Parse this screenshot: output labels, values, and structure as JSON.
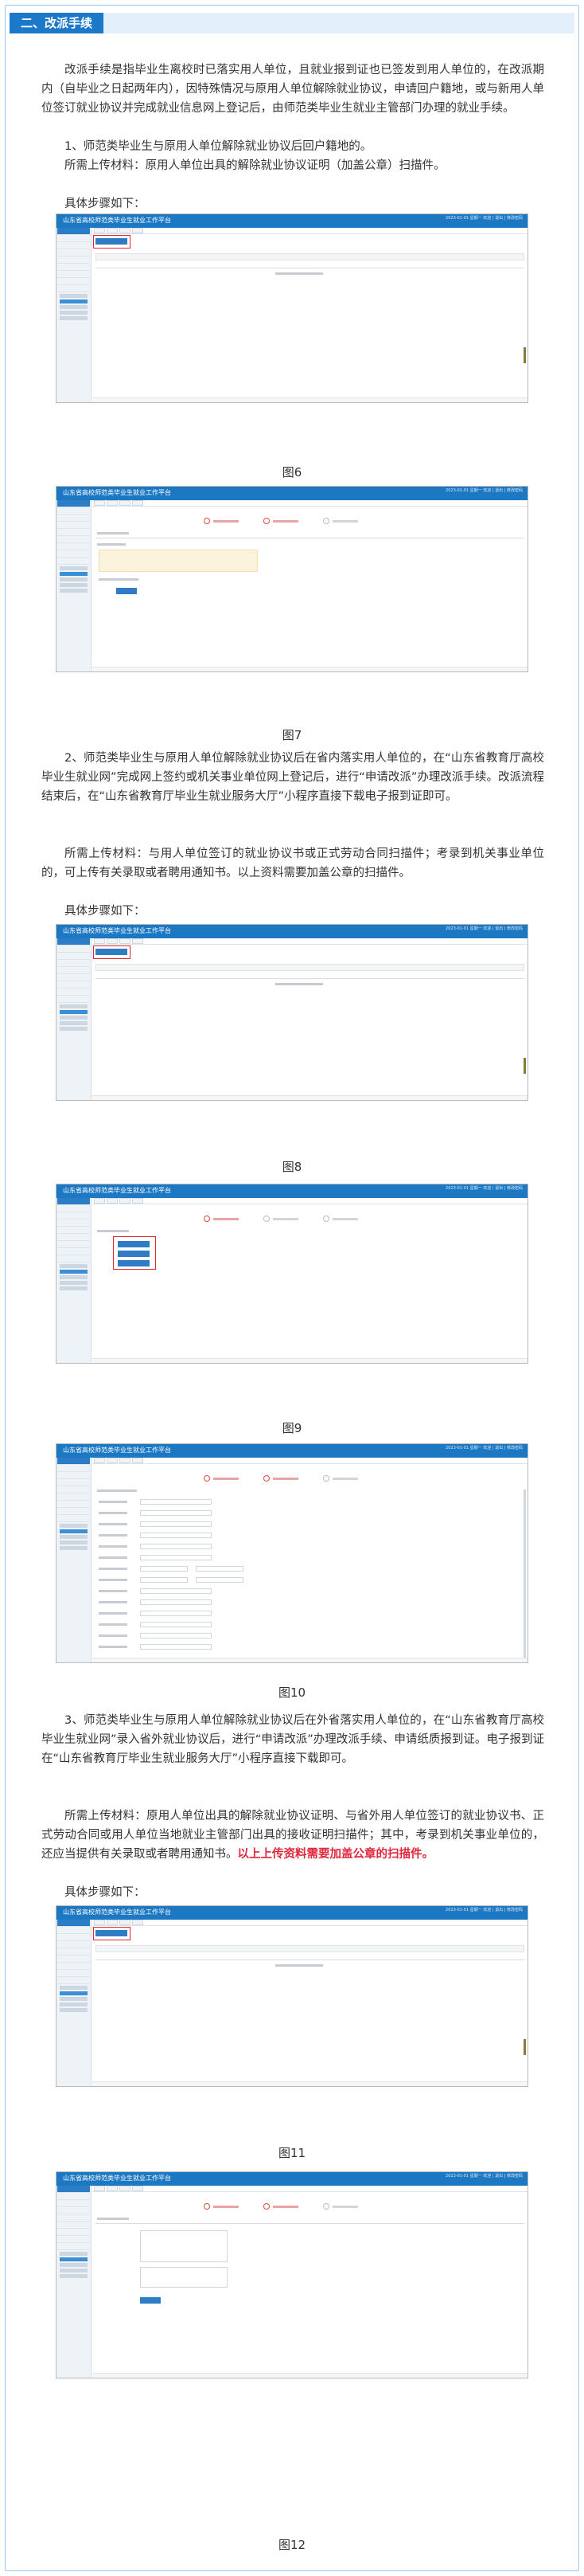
{
  "header": {
    "tag": "二、改派手续"
  },
  "intro": "改派手续是指毕业生离校时已落实用人单位，且就业报到证也已签发到用人单位的，在改派期内（自毕业之日起两年内），因特殊情况与原用人单位解除就业协议，申请回户籍地，或与新用人单位签订就业协议并完成就业信息网上登记后，由师范类毕业生就业主管部门办理的就业手续。",
  "s1": {
    "head": "1、师范类毕业生与原用人单位解除就业协议后回户籍地的。",
    "materials": "所需上传材料：原用人单位出具的解除就业协议证明（加盖公章）扫描件。",
    "steps": "具体步骤如下："
  },
  "s2": {
    "head": "2、师范类毕业生与原用人单位解除就业协议后在省内落实用人单位的，在“山东省教育厅高校毕业生就业网”完成网上签约或机关事业单位网上登记后，进行“申请改派”办理改派手续。改派流程结束后，在“山东省教育厅毕业生就业服务大厅”小程序直接下载电子报到证即可。",
    "materials": "所需上传材料：与用人单位签订的就业协议书或正式劳动合同扫描件；考录到机关事业单位的，可上传有关录取或者聘用通知书。以上资料需要加盖公章的扫描件。",
    "steps": "具体步骤如下："
  },
  "s3": {
    "head": "3、师范类毕业生与原用人单位解除就业协议后在外省落实用人单位的，在“山东省教育厅高校毕业生就业网”录入省外就业协议后，进行“申请改派”办理改派手续、申请纸质报到证。电子报到证在“山东省教育厅毕业生就业服务大厅”小程序直接下载即可。",
    "materials_a": "所需上传材料：原用人单位出具的解除就业协议证明、与省外用人单位签订的就业协议书、正式劳动合同或用人单位当地就业主管部门出具的接收证明扫描件；其中，考录到机关事业单位的，还应当提供有关录取或者聘用通知书。",
    "materials_red": "以上上传资料需要加盖公章的扫描件。",
    "steps": "具体步骤如下："
  },
  "screens": {
    "title": "山东省高校师范类毕业生就业工作平台",
    "user": "2023-01-01 星期一\n欢迎 | 退出 | 修改密码"
  },
  "captions": {
    "f6": "图6",
    "f7": "图7",
    "f8": "图8",
    "f9": "图9",
    "f10": "图10",
    "f11": "图11",
    "f12": "图12"
  }
}
